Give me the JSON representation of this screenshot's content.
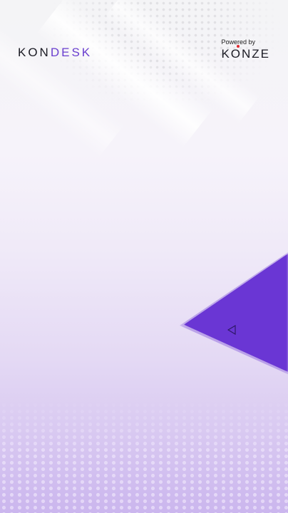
{
  "header": {
    "brand_prefix": "KON",
    "brand_suffix": "DESK",
    "powered_by_label": "Powered by",
    "powered_by_brand": "KONZE"
  },
  "side_tab": {
    "icon": "back-triangle-icon"
  },
  "colors": {
    "accent": "#6a36d4",
    "brand_accent": "#6a3fcf",
    "logo_dot": "#e0282e"
  }
}
